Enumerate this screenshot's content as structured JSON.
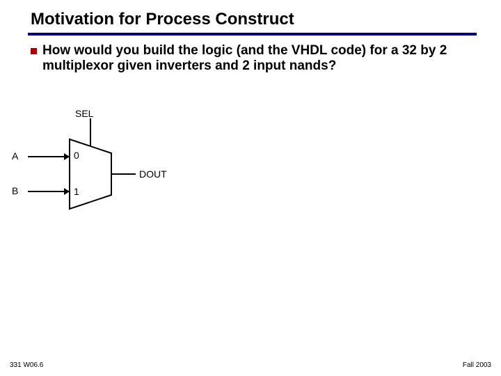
{
  "title": "Motivation for Process Construct",
  "question": "How would you build the logic (and the VHDL code) for a 32 by 2 multiplexor given inverters and 2 input nands?",
  "mux": {
    "sel": "SEL",
    "a": "A",
    "b": "B",
    "in0": "0",
    "in1": "1",
    "out": "DOUT"
  },
  "footer_left": "331 W06.6",
  "footer_right": "Fall 2003"
}
